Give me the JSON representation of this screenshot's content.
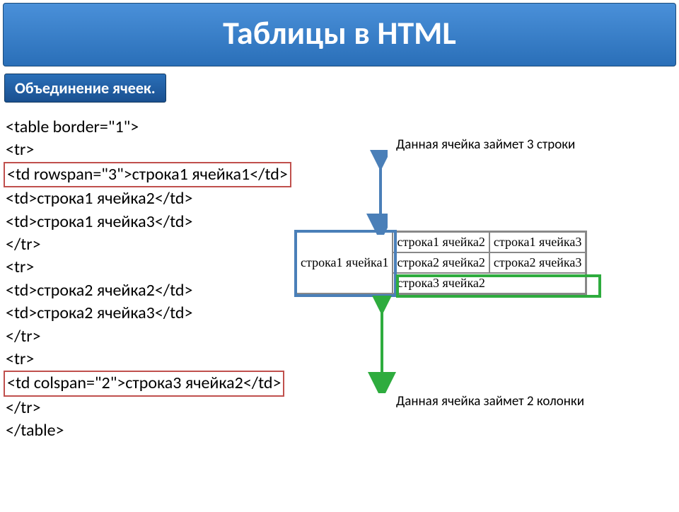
{
  "title": "Таблицы в HTML",
  "subtitle": "Объединение ячеек.",
  "code": {
    "l1": "<table border=\"1\">",
    "l2": "<tr>",
    "l3_boxed": "<td rowspan=\"3\">строка1 ячейка1</td>",
    "l4": "<td>строка1 ячейка2</td>",
    "l5": "<td>строка1 ячейка3</td>",
    "l6": "</tr>",
    "l7": "<tr>",
    "l8": "<td>строка2 ячейка2</td>",
    "l9": "<td>строка2 ячейка3</td>",
    "l10": "</tr>",
    "l11": "<tr>",
    "l12_boxed": "<td colspan=\"2\">строка3 ячейка2</td>",
    "l13": "</tr>",
    "l14": "</table>"
  },
  "note1": "Данная ячейка займет 3 строки",
  "note2": "Данная ячейка займет 2 колонки",
  "example": {
    "r1c1_rowspan": "строка1 ячейка1",
    "r1c2": "строка1 ячейка2",
    "r1c3": "строка1 ячейка3",
    "r2c2": "строка2 ячейка2",
    "r2c3": "строка2 ячейка3",
    "r3c2_colspan": "строка3 ячейка2"
  }
}
